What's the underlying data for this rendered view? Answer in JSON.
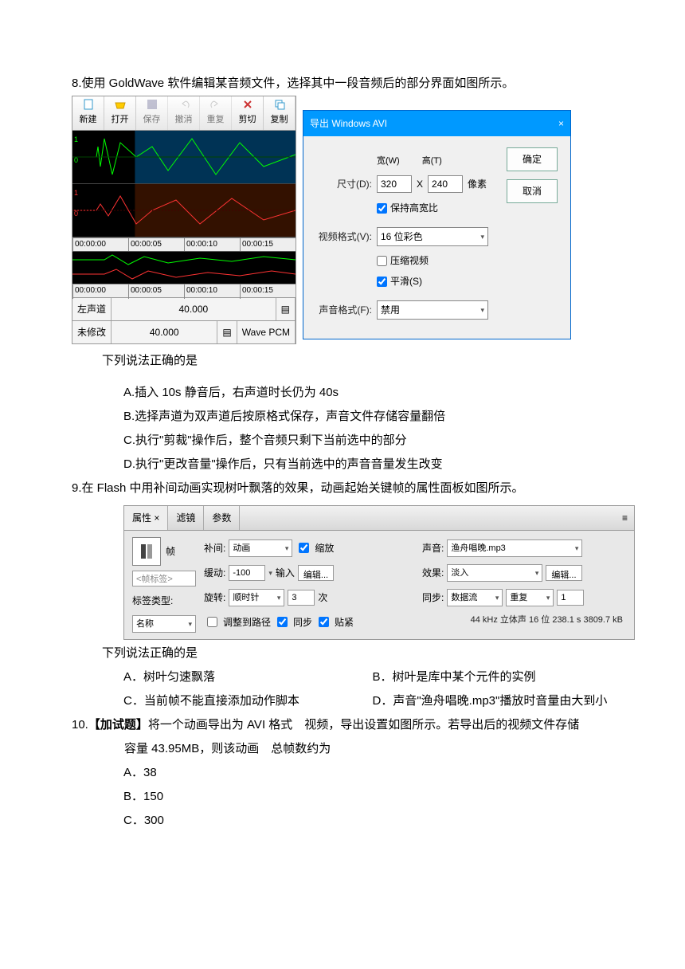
{
  "q8": {
    "num": "8.",
    "text": "使用 GoldWave 软件编辑某音频文件，选择其中一段音频后的部分界面如图所示。",
    "prompt": "下列说法正确的是",
    "opts": {
      "A": "A.插入 10s 静音后，右声道时长仍为 40s",
      "B": "B.选择声道为双声道后按原格式保存，声音文件存储容量翻倍",
      "C": "C.执行\"剪裁\"操作后，整个音频只剩下当前选中的部分",
      "D": "D.执行\"更改音量\"操作后，只有当前选中的声音音量发生改变"
    }
  },
  "gw": {
    "btns": [
      "新建",
      "打开",
      "保存",
      "撤消",
      "重复",
      "剪切",
      "复制"
    ],
    "tl": [
      "00:00:00",
      "00:00:05",
      "00:00:10",
      "00:00:15"
    ],
    "status": {
      "ch": "左声道",
      "chv": "40.000",
      "mod": "未修改",
      "modv": "40.000",
      "fmt": "Wave PCM"
    }
  },
  "avi": {
    "title": "导出 Windows AVI",
    "dim": "尺寸(D):",
    "w": "320",
    "wl": "宽(W)",
    "h": "240",
    "hl": "高(T)",
    "px": "像素",
    "x": "X",
    "keep": "保持高宽比",
    "vfmt": "视频格式(V):",
    "vfmtv": "16 位彩色",
    "comp": "压缩视频",
    "smooth": "平滑(S)",
    "afmt": "声音格式(F):",
    "afmtv": "禁用",
    "ok": "确定",
    "cancel": "取消",
    "close": "×"
  },
  "q9": {
    "num": "9.",
    "text": "在 Flash 中用补间动画实现树叶飘落的效果，动画起始关键帧的属性面板如图所示。",
    "prompt": "下列说法正确的是",
    "opts": {
      "A": "A．树叶匀速飘落",
      "B": "B．树叶是库中某个元件的实例",
      "C": "C．当前帧不能直接添加动作脚本",
      "D": "D．声音\"渔舟唱晚.mp3\"播放时音量由大到小"
    }
  },
  "fp": {
    "tabs": [
      "属性 ×",
      "滤镜",
      "参数"
    ],
    "frame": "帧",
    "tag": "<帧标签>",
    "labeltype": "标签类型:",
    "name": "名称",
    "tween": "补间:",
    "tweenv": "动画",
    "scale": "缩放",
    "ease": "缓动:",
    "easev": "-100",
    "easein": "输入",
    "edit": "编辑...",
    "rotate": "旋转:",
    "rotatev": "顺时针",
    "rotn": "3",
    "times": "次",
    "path": "调整到路径",
    "sync": "同步",
    "snap": "贴紧",
    "sound": "声音:",
    "soundv": "渔舟唱晚.mp3",
    "effect": "效果:",
    "effectv": "淡入",
    "effectbtn": "编辑...",
    "syncm": "同步:",
    "syncv": "数据流",
    "repeat": "重复",
    "repeatn": "1",
    "meta": "44 kHz 立体声 16 位 238.1 s 3809.7 kB"
  },
  "q10": {
    "num": "10.",
    "tag": "【加试题】",
    "text": "将一个动画导出为 AVI 格式　视频，导出设置如图所示。若导出后的视频文件存储",
    "text2": "容量 43.95MB，则该动画　总帧数约为",
    "opts": {
      "A": "A．38",
      "B": "B．150",
      "C": "C．300"
    }
  }
}
